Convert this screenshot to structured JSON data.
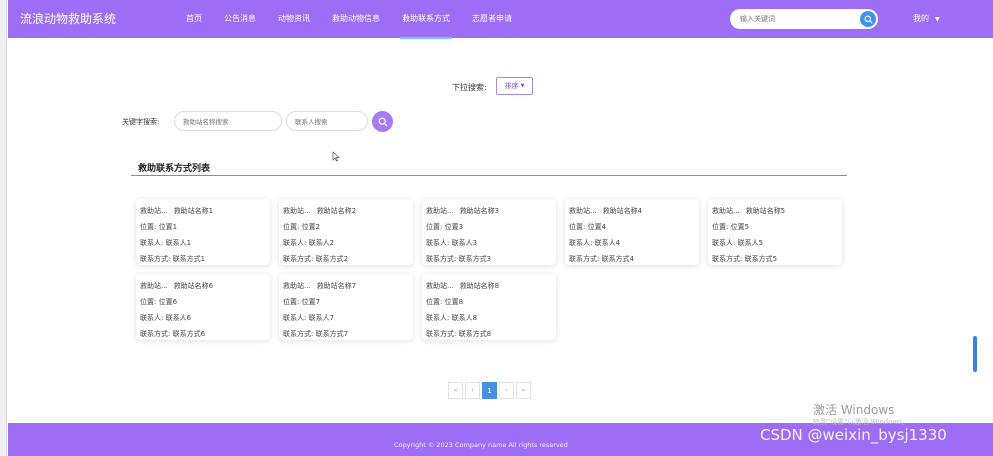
{
  "header": {
    "brand": "流浪动物救助系统",
    "nav": [
      {
        "label": "首页"
      },
      {
        "label": "公告消息"
      },
      {
        "label": "动物资讯"
      },
      {
        "label": "救助动物信息"
      },
      {
        "label": "救助联系方式",
        "active": true
      },
      {
        "label": "志愿者申请"
      }
    ],
    "search_placeholder": "输入关键词",
    "user_label": "我的"
  },
  "filter": {
    "dropdown_label": "下拉搜索:",
    "sort_label": "排序",
    "keyword_label": "关键字搜索:",
    "station_placeholder": "救助站名称搜索",
    "contact_placeholder": "联系人搜索"
  },
  "list": {
    "title": "救助联系方式列表",
    "field_labels": {
      "station": "救助站...",
      "position": "位置:",
      "contact": "联系人:",
      "phone": "联系方式:"
    },
    "cards": [
      {
        "station": "救助站名称1",
        "position": "位置1",
        "contact": "联系人1",
        "phone": "联系方式1"
      },
      {
        "station": "救助站名称2",
        "position": "位置2",
        "contact": "联系人2",
        "phone": "联系方式2"
      },
      {
        "station": "救助站名称3",
        "position": "位置3",
        "contact": "联系人3",
        "phone": "联系方式3"
      },
      {
        "station": "救助站名称4",
        "position": "位置4",
        "contact": "联系人4",
        "phone": "联系方式4"
      },
      {
        "station": "救助站名称5",
        "position": "位置5",
        "contact": "联系人5",
        "phone": "联系方式5"
      },
      {
        "station": "救助站名称6",
        "position": "位置6",
        "contact": "联系人6",
        "phone": "联系方式6"
      },
      {
        "station": "救助站名称7",
        "position": "位置7",
        "contact": "联系人7",
        "phone": "联系方式7"
      },
      {
        "station": "救助站名称8",
        "position": "位置8",
        "contact": "联系人8",
        "phone": "联系方式8"
      }
    ]
  },
  "pagination": {
    "first": "«",
    "prev": "‹",
    "current": "1",
    "next": "›",
    "last": "»"
  },
  "footer": {
    "copyright": "Copyright © 2023 Company name All rights reserved"
  },
  "overlay": {
    "windows_activate": "激活 Windows",
    "windows_activate_sub": "转到\"设置\"以激活 Windows。",
    "watermark": "CSDN @weixin_bysj1330"
  },
  "colors": {
    "primary": "#9d6df5",
    "search_button": "#4093f1",
    "active_underline": "#6ad2cf",
    "divider": "#c76aa6",
    "pager_active": "#4a90e2"
  }
}
